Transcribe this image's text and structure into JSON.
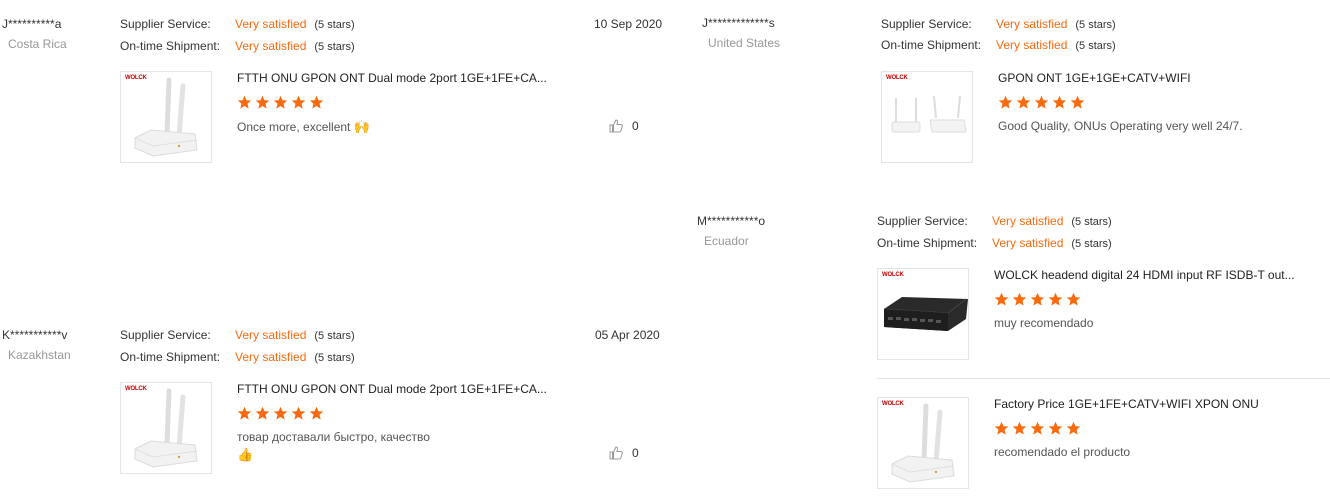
{
  "labels": {
    "supplier_service": "Supplier Service:",
    "on_time_shipment": "On-time Shipment:"
  },
  "colors": {
    "accent": "#f96a0e",
    "star": "#f96a0e"
  },
  "reviews": [
    {
      "buyer": "J**********a",
      "country": "Costa Rica",
      "date": "10 Sep 2020",
      "supplier_service": "Very satisfied",
      "supplier_stars": "(5 stars)",
      "shipment": "Very satisfied",
      "shipment_stars": "(5 stars)",
      "product": "FTTH ONU GPON ONT Dual mode 2port 1GE+1FE+CA...",
      "product_rating": 5,
      "comment": "Once more, excellent",
      "helpful_count": "0"
    },
    {
      "buyer": "K***********v",
      "country": "Kazakhstan",
      "date": "05 Apr 2020",
      "supplier_service": "Very satisfied",
      "supplier_stars": "(5 stars)",
      "shipment": "Very satisfied",
      "shipment_stars": "(5 stars)",
      "product": "FTTH ONU GPON ONT Dual mode 2port 1GE+1FE+CA...",
      "product_rating": 5,
      "comment": "товар доставали быстро, качество",
      "helpful_count": "0"
    },
    {
      "buyer": "J*************s",
      "country": "United States",
      "supplier_service": "Very satisfied",
      "supplier_stars": "(5 stars)",
      "shipment": "Very satisfied",
      "shipment_stars": "(5 stars)",
      "product": "GPON ONT 1GE+1GE+CATV+WIFI",
      "product_rating": 5,
      "comment": "Good Quality, ONUs Operating very well 24/7."
    },
    {
      "buyer": "M***********o",
      "country": "Ecuador",
      "supplier_service": "Very satisfied",
      "supplier_stars": "(5 stars)",
      "shipment": "Very satisfied",
      "shipment_stars": "(5 stars)",
      "products": [
        {
          "product": "WOLCK headend digital 24 HDMI input RF ISDB-T out...",
          "product_rating": 5,
          "comment": "muy recomendado"
        },
        {
          "product": "Factory Price 1GE+1FE+CATV+WIFI XPON ONU",
          "product_rating": 5,
          "comment": "recomendado el producto"
        }
      ]
    }
  ],
  "thumb_logo": "WOLCK"
}
